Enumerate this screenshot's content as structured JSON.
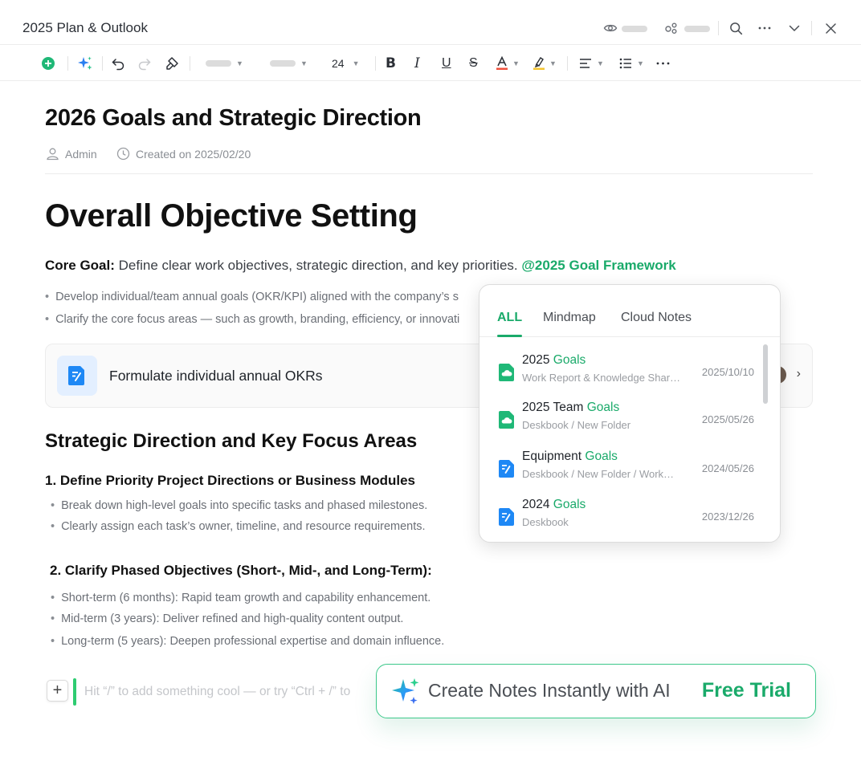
{
  "window": {
    "title": "2025 Plan & Outlook"
  },
  "toolbar": {
    "font_size": "24"
  },
  "document": {
    "title": "2026 Goals and Strategic Direction",
    "author": "Admin",
    "created": "Created on 2025/02/20",
    "heading1": "Overall Objective Setting",
    "core_goal": {
      "label": "Core Goal:",
      "text": " Define clear work objectives, strategic direction, and key priorities. ",
      "mention": "@2025 Goal Framework"
    },
    "core_bullets": [
      "Develop individual/team annual goals (OKR/KPI) aligned with the company’s s",
      "Clarify the core focus areas — such as growth, branding, efficiency, or innovati"
    ],
    "card": {
      "label": "Formulate individual annual OKRs"
    },
    "heading2": "Strategic Direction and Key Focus Areas",
    "section1": {
      "title": "1. Define Priority Project Directions or Business Modules",
      "bullets": [
        "Break down high-level goals into specific tasks and phased milestones.",
        "Clearly assign each task’s owner, timeline, and resource requirements."
      ]
    },
    "section2": {
      "title": "2. Clarify Phased Objectives (Short-, Mid-, and Long-Term):",
      "bullets": [
        "Short-term (6 months): Rapid team growth and capability enhancement.",
        "Mid-term (3 years): Deliver refined and high-quality content output.",
        "Long-term (5 years): Deepen professional expertise and domain influence."
      ]
    },
    "placeholder": "Hit “/” to add something cool — or try “Ctrl + /” to"
  },
  "popup": {
    "tabs": [
      "ALL",
      "Mindmap",
      "Cloud Notes"
    ],
    "active_tab": "ALL",
    "items": [
      {
        "name_prefix": "2025 ",
        "highlight": "Goals",
        "path": "Work Report & Knowledge Shar…",
        "date": "2025/10/10",
        "icon": "cloud-note-icon",
        "color": "#1fb877"
      },
      {
        "name_prefix": "2025 Team ",
        "highlight": "Goals",
        "path": "Deskbook / New Folder",
        "date": "2025/05/26",
        "icon": "cloud-note-icon",
        "color": "#1fb877"
      },
      {
        "name_prefix": "Equipment ",
        "highlight": "Goals",
        "path": "Deskbook / New Folder / Work…",
        "date": "2024/05/26",
        "icon": "document-icon",
        "color": "#1e88f5"
      },
      {
        "name_prefix": "2024 ",
        "highlight": "Goals",
        "path": "Deskbook",
        "date": "2023/12/26",
        "icon": "document-icon",
        "color": "#1e88f5"
      }
    ]
  },
  "ai_banner": {
    "text": "Create Notes Instantly with AI",
    "cta": "Free Trial"
  },
  "colors": {
    "accent": "#1aaa6a",
    "doc_blue": "#1e88f5"
  }
}
